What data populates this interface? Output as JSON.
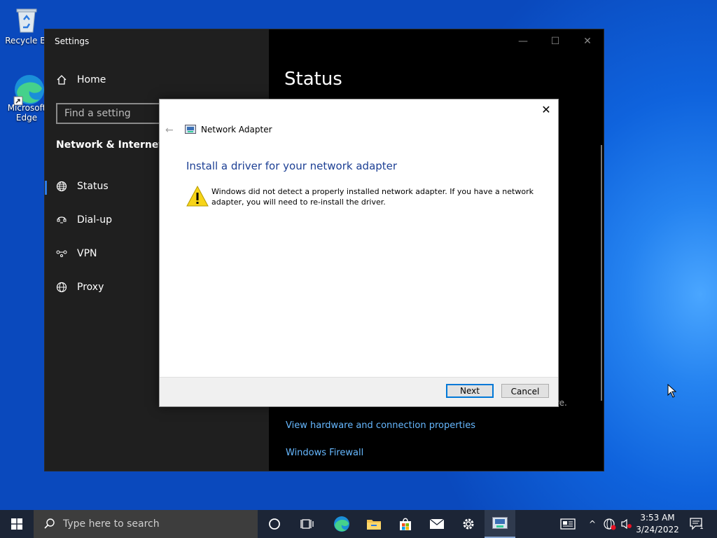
{
  "desktop": {
    "icons": [
      {
        "label": "Recycle Bi",
        "icon": "recycle-bin-icon"
      },
      {
        "label": "Microsoft Edge",
        "icon": "edge-icon"
      }
    ]
  },
  "settings": {
    "window_title": "Settings",
    "home_label": "Home",
    "search_placeholder": "Find a setting",
    "section": "Network & Internet",
    "nav": [
      {
        "label": "Status",
        "icon": "globe-icon",
        "selected": true
      },
      {
        "label": "Dial-up",
        "icon": "dialup-icon"
      },
      {
        "label": "VPN",
        "icon": "vpn-icon"
      },
      {
        "label": "Proxy",
        "icon": "globe-icon"
      }
    ],
    "heading": "Status",
    "partial_text": "re.",
    "links": [
      "View hardware and connection properties",
      "Windows Firewall"
    ]
  },
  "dialog": {
    "header": "Network Adapter",
    "title": "Install a driver for your network adapter",
    "message": "Windows did not detect a properly installed network adapter. If you have a network adapter, you will need to re-install the driver.",
    "next_label": "Next",
    "cancel_label": "Cancel"
  },
  "taskbar": {
    "search_placeholder": "Type here to search",
    "time": "3:53 AM",
    "date": "3/24/2022",
    "notification_count": "1",
    "apps": [
      "cortana-icon",
      "task-view-icon",
      "edge-icon",
      "file-explorer-icon",
      "store-icon",
      "mail-icon",
      "settings-icon",
      "network-wizard-icon"
    ]
  },
  "colors": {
    "accent": "#0078d7",
    "link": "#66b8ff",
    "dialog_title": "#1c3f94"
  }
}
